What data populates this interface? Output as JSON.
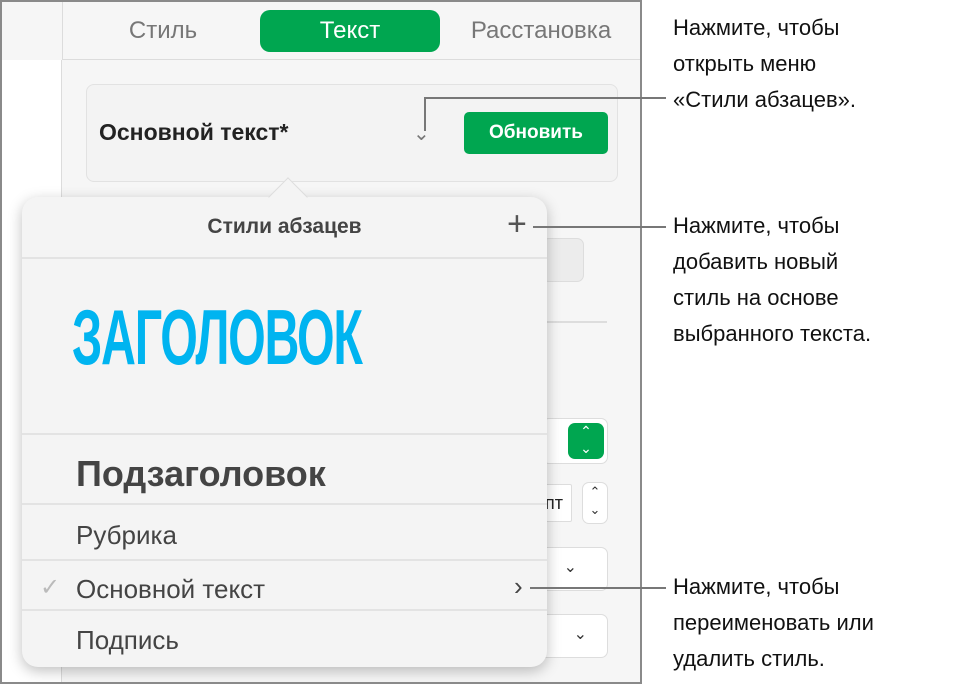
{
  "tabs": [
    {
      "label": "Стиль"
    },
    {
      "label": "Текст"
    },
    {
      "label": "Расстановка"
    }
  ],
  "style_box": {
    "name": "Основной текст*",
    "update_label": "Обновить"
  },
  "popover": {
    "title": "Стили абзацев",
    "items": [
      {
        "label": "ЗАГОЛОВОК"
      },
      {
        "label": "Подзаголовок"
      },
      {
        "label": "Рубрика"
      },
      {
        "label": "Основной текст",
        "checked": true
      },
      {
        "label": "Подпись"
      }
    ]
  },
  "partial_label": "пт",
  "callouts": [
    {
      "lines": [
        "Нажмите, чтобы",
        "открыть меню",
        "«Стили абзацев»."
      ]
    },
    {
      "lines": [
        "Нажмите, чтобы",
        "добавить новый",
        "стиль на основе",
        "выбранного текста."
      ]
    },
    {
      "lines": [
        "Нажмите, чтобы",
        "переименовать или",
        "удалить стиль."
      ]
    }
  ],
  "colors": {
    "accent": "#00a650",
    "heading": "#00b4f0"
  }
}
